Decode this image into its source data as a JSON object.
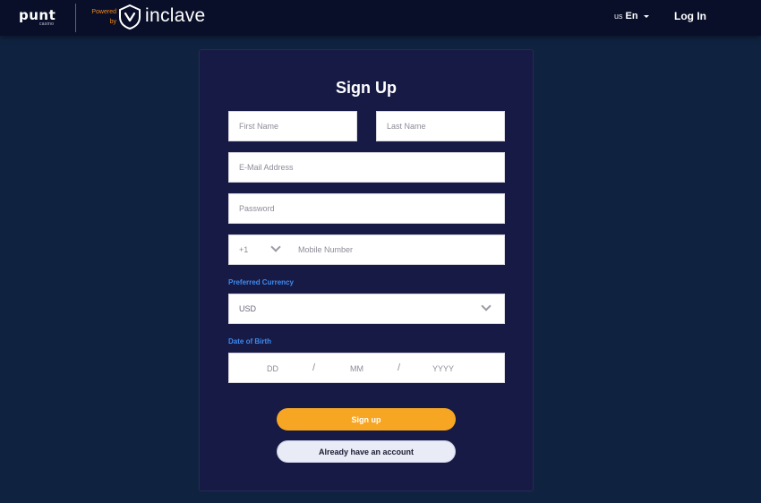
{
  "header": {
    "punt_logo_text": "punt",
    "punt_logo_subtext": "casino",
    "powered_by_line1": "Powered",
    "powered_by_line2": "by",
    "inclave_logo_text": "inclave",
    "language_flag": "us",
    "language_code": "En",
    "login_label": "Log In"
  },
  "form": {
    "title": "Sign Up",
    "first_name_placeholder": "First Name",
    "last_name_placeholder": "Last Name",
    "email_placeholder": "E-Mail Address",
    "password_placeholder": "Password",
    "phone_country_code": "+1",
    "mobile_placeholder": "Mobile Number",
    "currency_label": "Preferred Currency",
    "currency_value": "USD",
    "dob_label": "Date of Birth",
    "dob_day_placeholder": "DD",
    "dob_month_placeholder": "MM",
    "dob_year_placeholder": "YYYY",
    "dob_separator": "/",
    "signup_button": "Sign up",
    "account_button": "Already have an account"
  },
  "colors": {
    "page_background": "#0f2340",
    "header_background": "#0a0f29",
    "card_background": "#171a44",
    "label_blue": "#3d8bf0",
    "signup_orange": "#f7a623",
    "powered_orange": "#f08a1a"
  }
}
